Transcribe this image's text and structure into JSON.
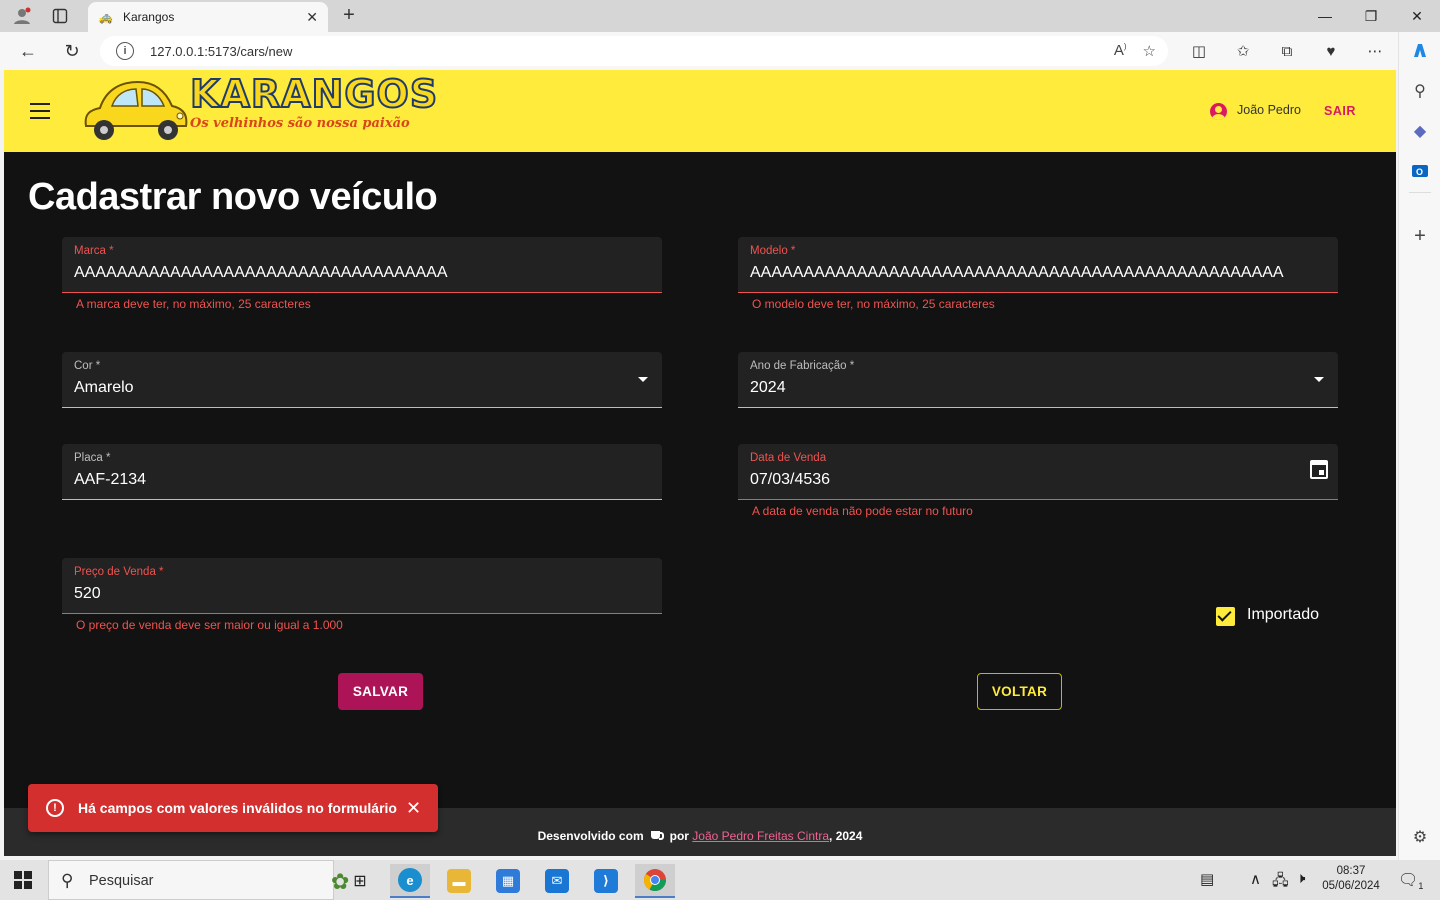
{
  "browser": {
    "tab_title": "Karangos",
    "url": "127.0.0.1:5173/cars/new",
    "new_tab": "+",
    "close_tab": "✕"
  },
  "header": {
    "logo_title": "KARANGOS",
    "logo_slogan": "Os velhinhos são nossa paixão",
    "user_name": "João Pedro",
    "logout_label": "SAIR"
  },
  "form": {
    "title": "Cadastrar novo veículo",
    "brand": {
      "label": "Marca *",
      "value": "AAAAAAAAAAAAAAAAAAAAAAAAAAAAAAAAAAA",
      "error": "A marca deve ter, no máximo, 25 caracteres"
    },
    "model": {
      "label": "Modelo *",
      "value": "AAAAAAAAAAAAAAAAAAAAAAAAAAAAAAAAAAAAAAAAAAAAAAAAAA",
      "error": "O modelo deve ter, no máximo, 25 caracteres"
    },
    "color": {
      "label": "Cor *",
      "value": "Amarelo"
    },
    "year": {
      "label": "Ano de Fabricação *",
      "value": "2024"
    },
    "plate": {
      "label": "Placa *",
      "value": "AAF-2134"
    },
    "sale_date": {
      "label": "Data de Venda",
      "value": "07/03/4536",
      "error": "A data de venda não pode estar no futuro"
    },
    "price": {
      "label": "Preço de Venda *",
      "value": "520",
      "error": "O preço de venda deve ser maior ou igual a 1.000"
    },
    "imported": {
      "label": "Importado",
      "checked": true
    },
    "save_label": "SALVAR",
    "back_label": "VOLTAR"
  },
  "snackbar": {
    "message": "Há campos com valores inválidos no formulário"
  },
  "footer": {
    "prefix": "Desenvolvido com",
    "by": "por",
    "author": "João Pedro Freitas Cintra",
    "suffix": ", 2024"
  },
  "taskbar": {
    "search_placeholder": "Pesquisar",
    "time": "08:37",
    "date": "05/06/2024",
    "notification_count": "1"
  },
  "colors": {
    "appbar": "#ffeb3b",
    "primary_button": "#ad1457",
    "error": "#ef5350",
    "page_bg": "#121212"
  }
}
